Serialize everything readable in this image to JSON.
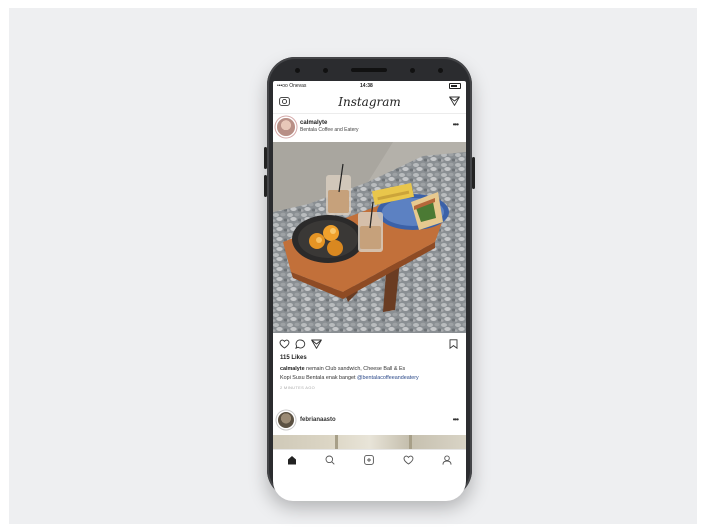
{
  "status_bar": {
    "carrier": "•••oo Onevas",
    "time": "14:38"
  },
  "top_bar": {
    "logo": "Instagram",
    "camera_icon": "camera-icon",
    "direct_icon": "paper-plane-icon"
  },
  "post": {
    "username": "calmalyte",
    "location": "Bentala Coffee and Eatery",
    "likes": "115 Likes",
    "caption_user": "calmalyte",
    "caption_line1": " nemain Club sandwich, Cheese Ball & Es",
    "caption_line2": "Kopi Susu Bentala enak banget ",
    "caption_tag": "@bentalacoffeeandeatery",
    "time_ago": "2 MINUTES AGO"
  },
  "post2": {
    "username": "febrianaasto"
  },
  "colors": {
    "stage": "#eeeff1",
    "phone": "#2b2c2f",
    "link": "#2c4a8a"
  }
}
